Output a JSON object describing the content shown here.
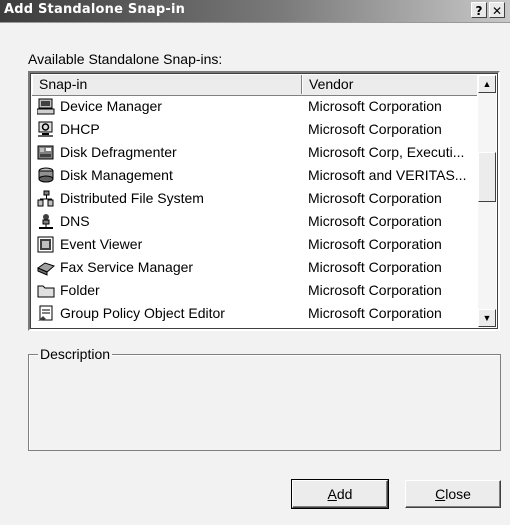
{
  "window": {
    "title": "Add Standalone Snap-in",
    "help_label": "?",
    "close_label": "✕"
  },
  "available_label": "Available Standalone Snap-ins:",
  "columns": {
    "snapin": "Snap-in",
    "vendor": "Vendor"
  },
  "rows": [
    {
      "name": "Device Manager",
      "vendor": "Microsoft Corporation",
      "icon": "device-manager-icon"
    },
    {
      "name": "DHCP",
      "vendor": "Microsoft Corporation",
      "icon": "dhcp-icon"
    },
    {
      "name": "Disk Defragmenter",
      "vendor": "Microsoft Corp, Executi...",
      "icon": "disk-defragmenter-icon"
    },
    {
      "name": "Disk Management",
      "vendor": "Microsoft and VERITAS...",
      "icon": "disk-management-icon"
    },
    {
      "name": "Distributed File System",
      "vendor": "Microsoft Corporation",
      "icon": "distributed-file-system-icon"
    },
    {
      "name": "DNS",
      "vendor": "Microsoft Corporation",
      "icon": "dns-icon"
    },
    {
      "name": "Event Viewer",
      "vendor": "Microsoft Corporation",
      "icon": "event-viewer-icon"
    },
    {
      "name": "Fax Service Manager",
      "vendor": "Microsoft Corporation",
      "icon": "fax-service-icon"
    },
    {
      "name": "Folder",
      "vendor": "Microsoft Corporation",
      "icon": "folder-icon"
    },
    {
      "name": "Group Policy Object Editor",
      "vendor": "Microsoft Corporation",
      "icon": "group-policy-icon"
    }
  ],
  "scrollbar": {
    "up": "▲",
    "down": "▼"
  },
  "description_label": "Description",
  "buttons": {
    "add_mnemonic": "A",
    "add_rest": "dd",
    "close_mnemonic": "C",
    "close_rest": "lose"
  }
}
